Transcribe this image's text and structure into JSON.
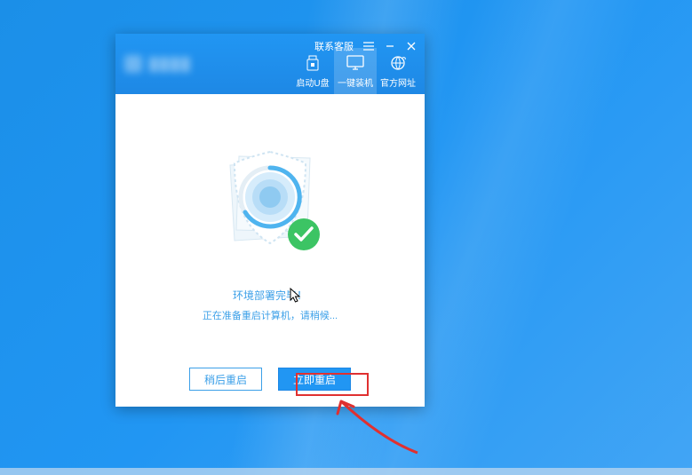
{
  "titlebar": {
    "contact_label": "联系客服"
  },
  "tabs": {
    "usb": "启动U盘",
    "one_click": "一键装机",
    "official": "官方网址"
  },
  "status": {
    "line1": "环境部署完毕！",
    "line2": "正在准备重启计算机，请稍候..."
  },
  "buttons": {
    "later": "稍后重启",
    "now": "立即重启"
  },
  "colors": {
    "primary": "#2196f3",
    "success": "#3cc464",
    "accent_text": "#3ca0e8",
    "annotation": "#e03030"
  }
}
